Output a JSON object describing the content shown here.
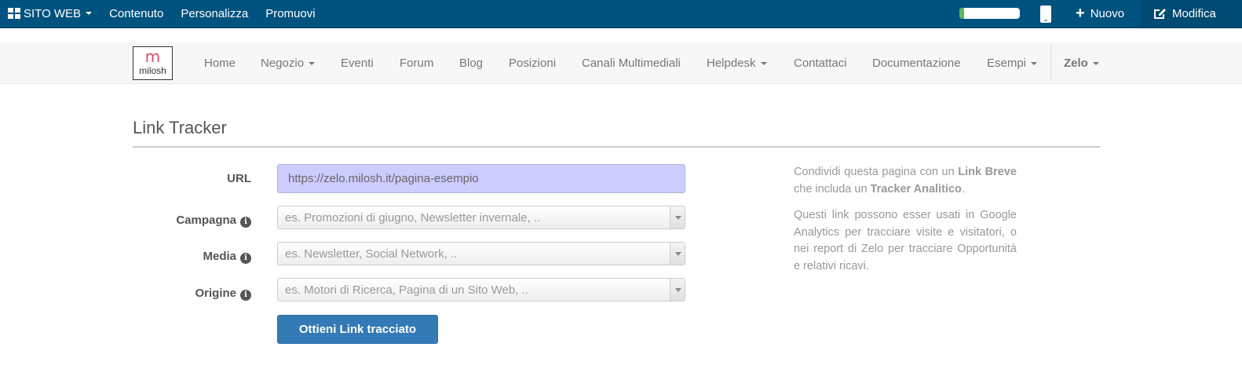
{
  "topbar": {
    "site_menu": "SITO WEB",
    "items": [
      "Contenuto",
      "Personalizza",
      "Promuovi"
    ],
    "progress_fraction": 0.08,
    "new_label": "Nuovo",
    "edit_label": "Modifica",
    "icons": {
      "site": "grid-icon",
      "device": "mobile-phone-icon",
      "new": "plus-icon",
      "edit": "edit-icon"
    }
  },
  "navbar": {
    "logo_mark": "m",
    "logo_text": "milosh",
    "items": [
      {
        "label": "Home",
        "dropdown": false
      },
      {
        "label": "Negozio",
        "dropdown": true
      },
      {
        "label": "Eventi",
        "dropdown": false
      },
      {
        "label": "Forum",
        "dropdown": false
      },
      {
        "label": "Blog",
        "dropdown": false
      },
      {
        "label": "Posizioni",
        "dropdown": false
      },
      {
        "label": "Canali Multimediali",
        "dropdown": false
      },
      {
        "label": "Helpdesk",
        "dropdown": true
      },
      {
        "label": "Contattaci",
        "dropdown": false
      },
      {
        "label": "Documentazione",
        "dropdown": false
      },
      {
        "label": "Esempi",
        "dropdown": true
      }
    ],
    "user": "Zelo"
  },
  "page": {
    "title": "Link Tracker",
    "form": {
      "url_label": "URL",
      "url_value": "https://zelo.milosh.it/pagina-esempio",
      "campaign_label": "Campagna",
      "campaign_placeholder": "es. Promozioni di giugno, Newsletter invernale, ..",
      "medium_label": "Media",
      "medium_placeholder": "es. Newsletter, Social Network, ..",
      "source_label": "Origine",
      "source_placeholder": "es. Motori di Ricerca, Pagina di un Sito Web, ..",
      "submit_label": "Ottieni Link tracciato"
    },
    "help": {
      "p1_a": "Condividi questa pagina con un ",
      "p1_b": "Link Breve",
      "p1_c": " che includa un ",
      "p1_d": "Tracker Analitico",
      "p1_e": ".",
      "p2": "Questi link possono esser usati in Google Analytics per tracciare visite e visitatori, o nei report di Zelo per tracciare Opportunità e relativi ricavi."
    }
  },
  "colors": {
    "topbar_bg": "#00527f",
    "url_input_bg": "#ccccff",
    "primary_button": "#337ab7",
    "logo_accent": "#e34a6f"
  }
}
